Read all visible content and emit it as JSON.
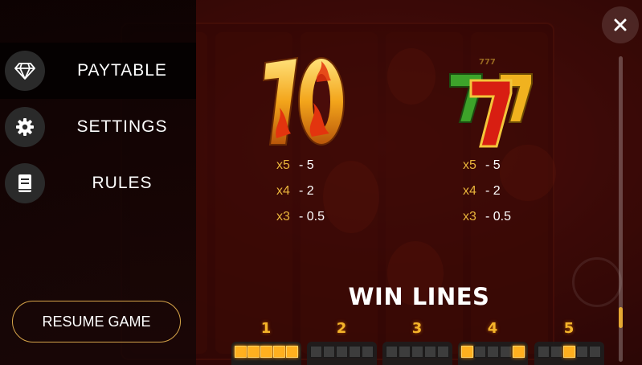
{
  "menu": {
    "items": [
      {
        "label": "PAYTABLE",
        "icon": "diamond-icon",
        "active": true
      },
      {
        "label": "SETTINGS",
        "icon": "gear-icon",
        "active": false
      },
      {
        "label": "RULES",
        "icon": "book-icon",
        "active": false
      }
    ],
    "resume_label": "RESUME GAME"
  },
  "paytable": {
    "symbols": [
      {
        "name": "flaming-ten",
        "payouts": [
          {
            "mult": "x5",
            "value": "- 5"
          },
          {
            "mult": "x4",
            "value": "- 2"
          },
          {
            "mult": "x3",
            "value": "- 0.5"
          }
        ]
      },
      {
        "name": "triple-seven",
        "payouts": [
          {
            "mult": "x5",
            "value": "- 5"
          },
          {
            "mult": "x4",
            "value": "- 2"
          },
          {
            "mult": "x3",
            "value": "- 0.5"
          }
        ]
      }
    ],
    "winlines_title": "WIN LINES",
    "lines": [
      {
        "number": "1",
        "pattern": [
          1,
          1,
          1,
          1,
          1
        ]
      },
      {
        "number": "2",
        "pattern": [
          0,
          0,
          0,
          0,
          0
        ]
      },
      {
        "number": "3",
        "pattern": [
          0,
          0,
          0,
          0,
          0
        ]
      },
      {
        "number": "4",
        "pattern": [
          1,
          0,
          0,
          0,
          1
        ]
      },
      {
        "number": "5",
        "pattern": [
          0,
          0,
          1,
          0,
          0
        ]
      }
    ]
  },
  "colors": {
    "accent_gold": "#e9b43b",
    "line_on": "#ffb01f",
    "menu_active_bg": "#050101"
  }
}
